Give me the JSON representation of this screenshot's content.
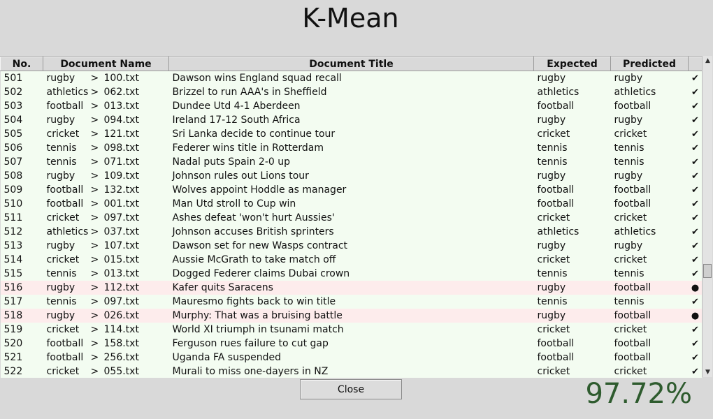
{
  "window": {
    "title": "K-Mean"
  },
  "table": {
    "columns": [
      "No.",
      "Document Name",
      "Document Title",
      "Expected",
      "Predicted",
      ""
    ],
    "rows": [
      {
        "no": "501",
        "category": "rugby",
        "file": "100.txt",
        "title": "Dawson wins England squad recall",
        "expected": "rugby",
        "predicted": "rugby",
        "mark": "✔",
        "correct": true
      },
      {
        "no": "502",
        "category": "athletics",
        "file": "062.txt",
        "title": "Brizzel to run AAA's in Sheffield",
        "expected": "athletics",
        "predicted": "athletics",
        "mark": "✔",
        "correct": true
      },
      {
        "no": "503",
        "category": "football",
        "file": "013.txt",
        "title": "Dundee Utd 4-1 Aberdeen",
        "expected": "football",
        "predicted": "football",
        "mark": "✔",
        "correct": true
      },
      {
        "no": "504",
        "category": "rugby",
        "file": "094.txt",
        "title": "Ireland 17-12 South Africa",
        "expected": "rugby",
        "predicted": "rugby",
        "mark": "✔",
        "correct": true
      },
      {
        "no": "505",
        "category": "cricket",
        "file": "121.txt",
        "title": "Sri Lanka decide to continue tour",
        "expected": "cricket",
        "predicted": "cricket",
        "mark": "✔",
        "correct": true
      },
      {
        "no": "506",
        "category": "tennis",
        "file": "098.txt",
        "title": "Federer wins title in Rotterdam",
        "expected": "tennis",
        "predicted": "tennis",
        "mark": "✔",
        "correct": true
      },
      {
        "no": "507",
        "category": "tennis",
        "file": "071.txt",
        "title": "Nadal puts Spain 2-0 up",
        "expected": "tennis",
        "predicted": "tennis",
        "mark": "✔",
        "correct": true
      },
      {
        "no": "508",
        "category": "rugby",
        "file": "109.txt",
        "title": "Johnson rules out Lions tour",
        "expected": "rugby",
        "predicted": "rugby",
        "mark": "✔",
        "correct": true
      },
      {
        "no": "509",
        "category": "football",
        "file": "132.txt",
        "title": "Wolves appoint Hoddle as manager",
        "expected": "football",
        "predicted": "football",
        "mark": "✔",
        "correct": true
      },
      {
        "no": "510",
        "category": "football",
        "file": "001.txt",
        "title": "Man Utd stroll to Cup win",
        "expected": "football",
        "predicted": "football",
        "mark": "✔",
        "correct": true
      },
      {
        "no": "511",
        "category": "cricket",
        "file": "097.txt",
        "title": "Ashes defeat 'won't hurt Aussies'",
        "expected": "cricket",
        "predicted": "cricket",
        "mark": "✔",
        "correct": true
      },
      {
        "no": "512",
        "category": "athletics",
        "file": "037.txt",
        "title": "Johnson accuses British sprinters",
        "expected": "athletics",
        "predicted": "athletics",
        "mark": "✔",
        "correct": true
      },
      {
        "no": "513",
        "category": "rugby",
        "file": "107.txt",
        "title": "Dawson set for new Wasps contract",
        "expected": "rugby",
        "predicted": "rugby",
        "mark": "✔",
        "correct": true
      },
      {
        "no": "514",
        "category": "cricket",
        "file": "015.txt",
        "title": "Aussie McGrath to take match off",
        "expected": "cricket",
        "predicted": "cricket",
        "mark": "✔",
        "correct": true
      },
      {
        "no": "515",
        "category": "tennis",
        "file": "013.txt",
        "title": "Dogged Federer claims Dubai crown",
        "expected": "tennis",
        "predicted": "tennis",
        "mark": "✔",
        "correct": true
      },
      {
        "no": "516",
        "category": "rugby",
        "file": "112.txt",
        "title": "Kafer quits Saracens",
        "expected": "rugby",
        "predicted": "football",
        "mark": "●",
        "correct": false
      },
      {
        "no": "517",
        "category": "tennis",
        "file": "097.txt",
        "title": "Mauresmo fights back to win title",
        "expected": "tennis",
        "predicted": "tennis",
        "mark": "✔",
        "correct": true
      },
      {
        "no": "518",
        "category": "rugby",
        "file": "026.txt",
        "title": "Murphy: That was a bruising battle",
        "expected": "rugby",
        "predicted": "football",
        "mark": "●",
        "correct": false
      },
      {
        "no": "519",
        "category": "cricket",
        "file": "114.txt",
        "title": "World XI triumph in tsunami match",
        "expected": "cricket",
        "predicted": "cricket",
        "mark": "✔",
        "correct": true
      },
      {
        "no": "520",
        "category": "football",
        "file": "158.txt",
        "title": "Ferguson rues failure to cut gap",
        "expected": "football",
        "predicted": "football",
        "mark": "✔",
        "correct": true
      },
      {
        "no": "521",
        "category": "football",
        "file": "256.txt",
        "title": "Uganda FA suspended",
        "expected": "football",
        "predicted": "football",
        "mark": "✔",
        "correct": true
      },
      {
        "no": "522",
        "category": "cricket",
        "file": "055.txt",
        "title": "Murali to miss one-dayers in NZ",
        "expected": "cricket",
        "predicted": "cricket",
        "mark": "✔",
        "correct": true
      }
    ]
  },
  "path_separator": ">",
  "close_label": "Close",
  "accuracy": "97.72%",
  "colors": {
    "correct_row": "#f3fcf1",
    "incorrect_row": "#fdecec",
    "accuracy_text": "#2e5b2e"
  },
  "icons": {
    "correct": "check-icon",
    "incorrect": "dot-icon",
    "scroll_up": "arrow-up-icon",
    "scroll_down": "arrow-down-icon"
  }
}
